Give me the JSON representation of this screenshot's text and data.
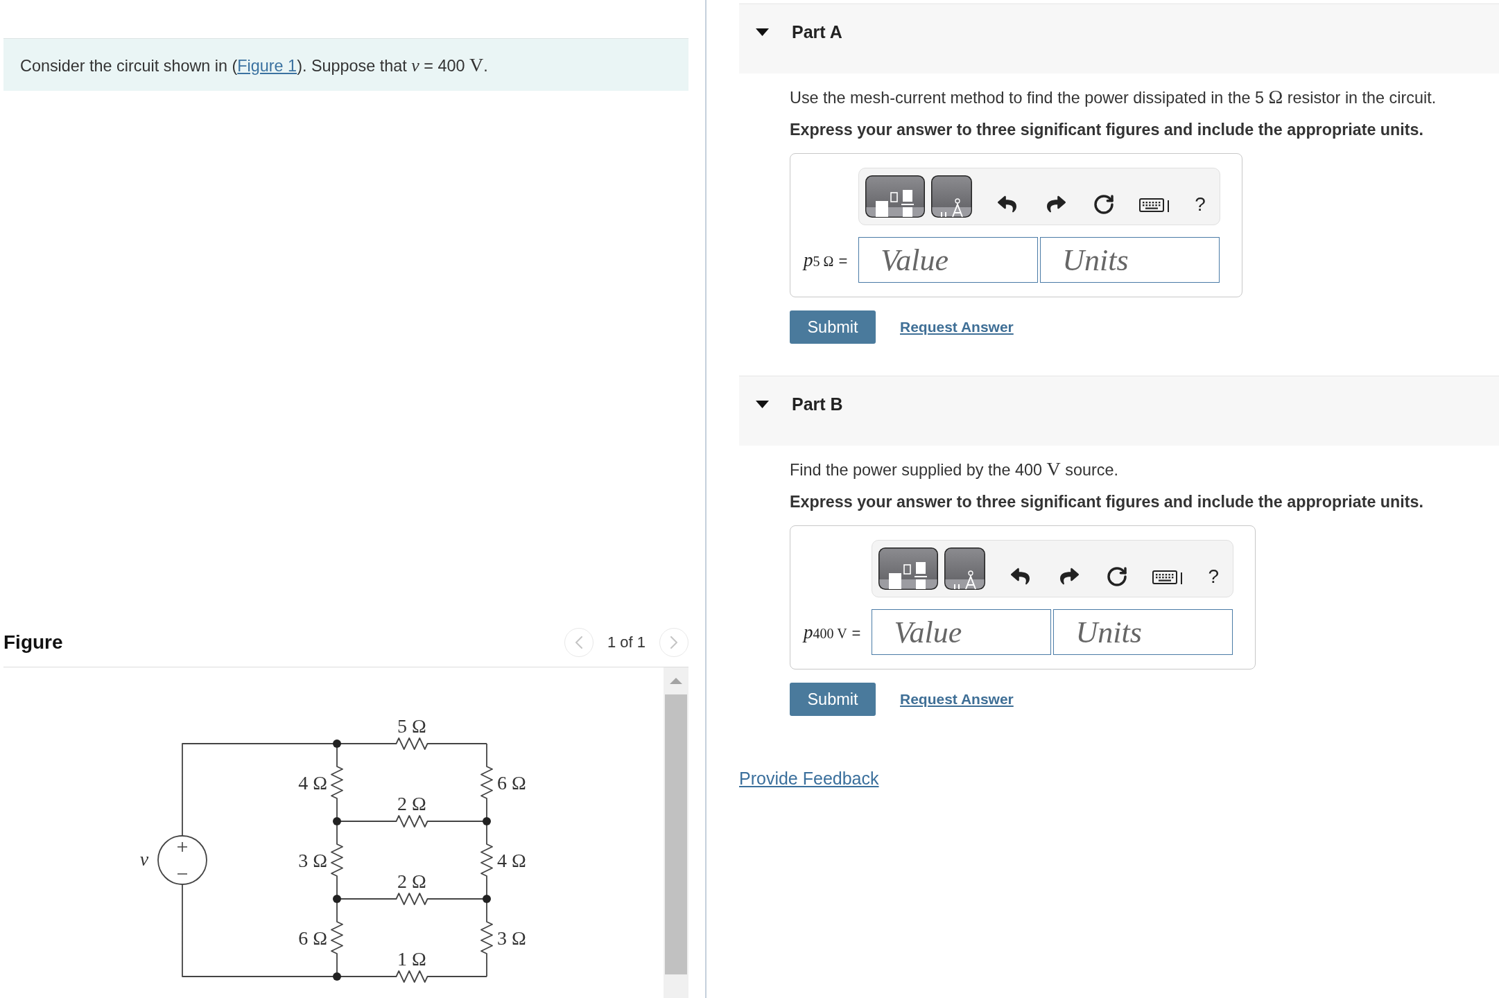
{
  "problem": {
    "parts": [
      {
        "kind": "text",
        "text": "Consider the circuit shown in ("
      },
      {
        "kind": "link",
        "text": "Figure 1"
      },
      {
        "kind": "text",
        "text": "). Suppose that "
      },
      {
        "kind": "variable",
        "text": "v"
      },
      {
        "kind": "text",
        "text": " = 400 "
      },
      {
        "kind": "unit",
        "text": "V"
      },
      {
        "kind": "text",
        "text": "."
      }
    ]
  },
  "figure": {
    "heading": "Figure",
    "pager": {
      "previous": {
        "disabled": true
      },
      "label": "1 of 1",
      "next": {
        "disabled": true
      }
    },
    "circuit": {
      "source_label": "v",
      "rungs": [
        "5 Ω",
        "2 Ω",
        "2 Ω",
        "1 Ω"
      ],
      "left_column": [
        "4 Ω",
        "3 Ω",
        "6 Ω"
      ],
      "right_column": [
        "6 Ω",
        "4 Ω",
        "3 Ω"
      ]
    }
  },
  "parts": [
    {
      "title": "Part A",
      "expanded": true,
      "question": [
        {
          "kind": "text",
          "text": "Use the mesh-current method to find the power dissipated in the 5 "
        },
        {
          "kind": "unit",
          "text": "Ω"
        },
        {
          "kind": "text",
          "text": " resistor in the circuit."
        }
      ],
      "instruction": "Express your answer to three significant figures and include the appropriate units.",
      "toolbar": {
        "help": "?"
      },
      "answer": {
        "variable": "p",
        "subscript": "5 Ω",
        "relation": "=",
        "value_placeholder": "Value",
        "units_placeholder": "Units"
      },
      "submit": "Submit",
      "request_answer": "Request Answer"
    },
    {
      "title": "Part B",
      "expanded": true,
      "question": [
        {
          "kind": "text",
          "text": "Find the power supplied by the 400 "
        },
        {
          "kind": "unit",
          "text": "V"
        },
        {
          "kind": "text",
          "text": " source."
        }
      ],
      "instruction": "Express your answer to three significant figures and include the appropriate units.",
      "toolbar": {
        "help": "?"
      },
      "answer": {
        "variable": "p",
        "subscript": "400 V",
        "relation": "=",
        "value_placeholder": "Value",
        "units_placeholder": "Units"
      },
      "submit": "Submit",
      "request_answer": "Request Answer"
    }
  ],
  "feedback_link": "Provide Feedback"
}
